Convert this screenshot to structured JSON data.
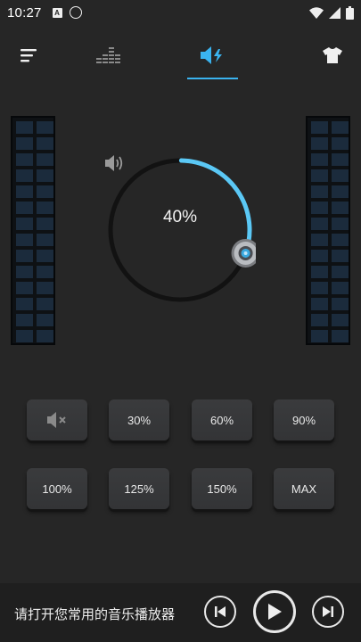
{
  "status_bar": {
    "time": "10:27",
    "left_icons": [
      "notification-a-icon",
      "download-icon"
    ],
    "right_icons": [
      "wifi-icon",
      "signal-icon",
      "battery-icon"
    ]
  },
  "nav": {
    "tabs": [
      "menu-icon",
      "equalizer-icon",
      "volume-boost-icon",
      "skin-icon"
    ],
    "active_tab": "volume-boost-icon",
    "accent": "#3ab3ef"
  },
  "dial": {
    "value_label": "40%",
    "value": 40,
    "arc_color": "#5bc8f5"
  },
  "presets": {
    "mute_icon": "mute-icon",
    "p30": "30%",
    "p60": "60%",
    "p90": "90%",
    "p100": "100%",
    "p125": "125%",
    "p150": "150%",
    "max": "MAX"
  },
  "player": {
    "prompt": "请打开您常用的音乐播放器",
    "controls": [
      "previous-icon",
      "play-icon",
      "next-icon"
    ]
  },
  "meters": {
    "level": 0,
    "cell_color": "#1b2b3c"
  }
}
